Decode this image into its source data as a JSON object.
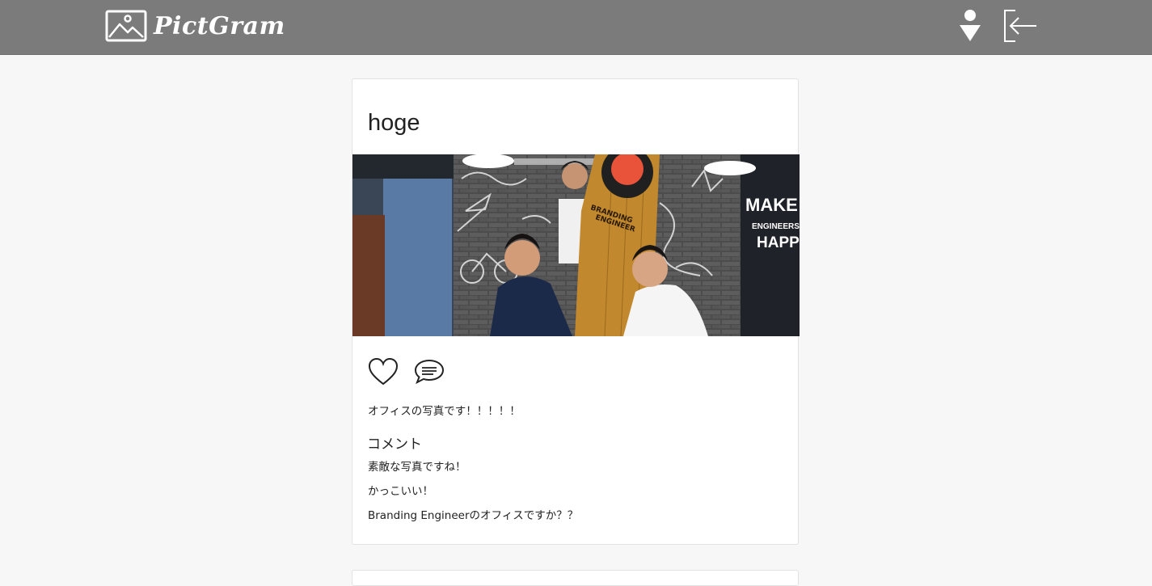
{
  "header": {
    "brand_name": "PictGram",
    "brand_icon": "image-icon",
    "user_icon": "user-icon",
    "logout_icon": "logout-icon"
  },
  "post": {
    "title": "hoge",
    "photo_wall_text": [
      "MAKE",
      "ENGINEERS",
      "HAPPY"
    ],
    "board_text": [
      "BRANDING",
      "ENGINEER"
    ],
    "like_icon": "heart-icon",
    "comment_icon": "speech-bubble-icon",
    "caption": "オフィスの写真です！！！！！",
    "comments_heading": "コメント",
    "comments": [
      "素敵な写真ですね！",
      "かっこいい！",
      "Branding Engineerのオフィスですか？？"
    ]
  },
  "colors": {
    "header_bg": "#7b7b7b",
    "page_bg": "#f7f7f7",
    "card_bg": "#ffffff"
  }
}
